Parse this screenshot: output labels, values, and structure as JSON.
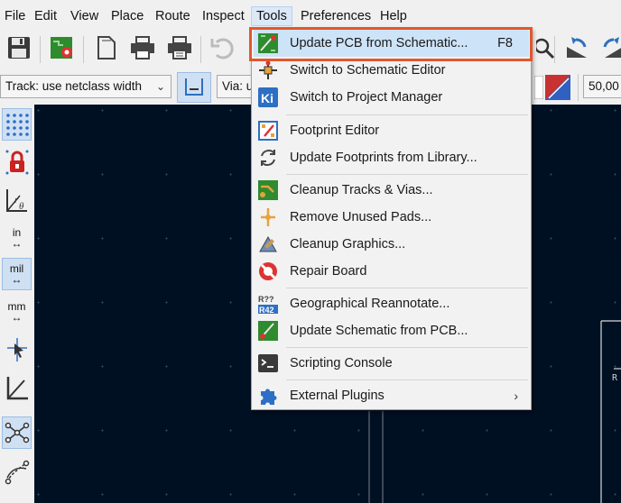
{
  "menubar": {
    "items": [
      "File",
      "Edit",
      "View",
      "Place",
      "Route",
      "Inspect",
      "Tools",
      "Preferences",
      "Help"
    ]
  },
  "toolbar": {
    "track_select": "Track: use netclass width",
    "via_select": "Via: u",
    "zoom_value": "50,00"
  },
  "tools_menu": {
    "items": [
      {
        "label": "Update PCB from Schematic...",
        "shortcut": "F8",
        "icon": "update-pcb-icon"
      },
      {
        "label": "Switch to Schematic Editor",
        "icon": "schematic-editor-icon"
      },
      {
        "label": "Switch to Project Manager",
        "icon": "kicad-icon"
      },
      {
        "label": "Footprint Editor",
        "icon": "footprint-editor-icon"
      },
      {
        "label": "Update Footprints from Library...",
        "icon": "refresh-icon"
      },
      {
        "label": "Cleanup Tracks & Vias...",
        "icon": "cleanup-tracks-icon"
      },
      {
        "label": "Remove Unused Pads...",
        "icon": "remove-pads-icon"
      },
      {
        "label": "Cleanup Graphics...",
        "icon": "cleanup-graphics-icon"
      },
      {
        "label": "Repair Board",
        "icon": "repair-board-icon"
      },
      {
        "label": "Geographical Reannotate...",
        "icon": "reannotate-icon"
      },
      {
        "label": "Update Schematic from PCB...",
        "icon": "update-schematic-icon"
      },
      {
        "label": "Scripting Console",
        "icon": "console-icon"
      },
      {
        "label": "External Plugins",
        "icon": "puzzle-icon",
        "submenu": true
      }
    ]
  },
  "left_toolbar": {
    "unit_in": "in",
    "unit_mil": "mil",
    "unit_mm": "mm"
  },
  "canvas_label": "R",
  "colors": {
    "canvas_bg": "#001023",
    "highlight": "#e2572b",
    "menu_hover": "#cde3f8"
  }
}
